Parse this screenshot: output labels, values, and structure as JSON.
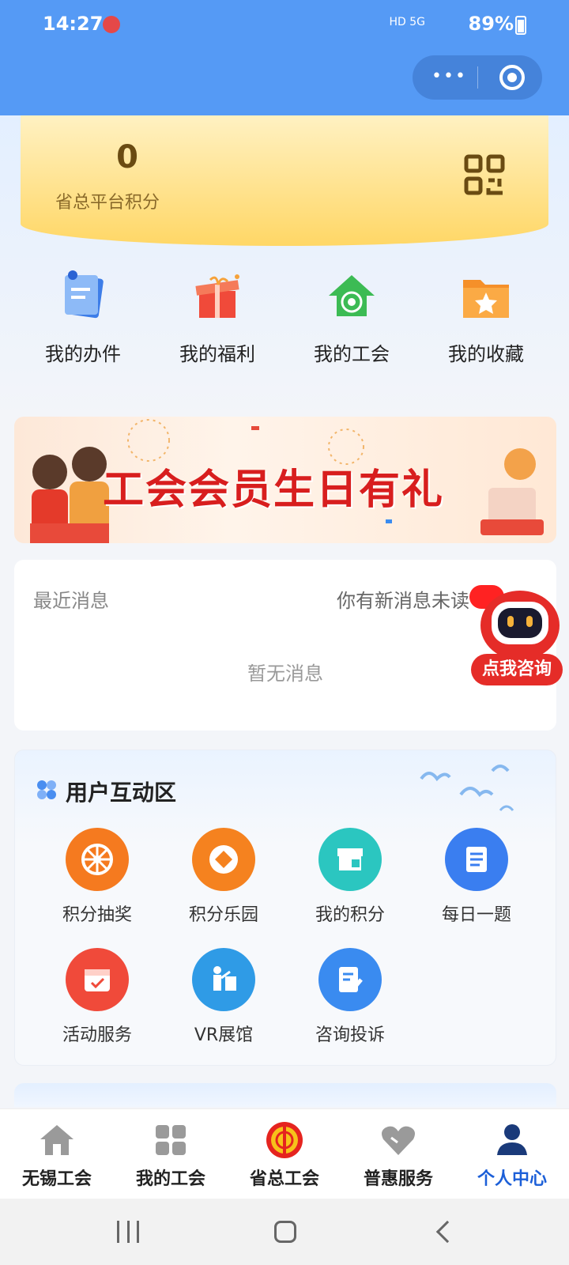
{
  "status": {
    "time": "14:27",
    "signal_text": "HD 5G",
    "battery": "89%"
  },
  "points": {
    "value": "0",
    "label": "省总平台积分"
  },
  "quick_menu": [
    {
      "label": "我的办件",
      "icon": "document-icon"
    },
    {
      "label": "我的福利",
      "icon": "gift-icon"
    },
    {
      "label": "我的工会",
      "icon": "union-home-icon"
    },
    {
      "label": "我的收藏",
      "icon": "favorite-folder-icon"
    }
  ],
  "banner": {
    "title": "工会会员生日有礼"
  },
  "messages": {
    "title": "最近消息",
    "unread_text": "你有新消息未读",
    "empty_text": "暂无消息"
  },
  "assistant": {
    "label": "点我咨询"
  },
  "interaction": {
    "title": "用户互动区",
    "items": [
      {
        "label": "积分抽奖",
        "color": "#f57a1f"
      },
      {
        "label": "积分乐园",
        "color": "#f5821f"
      },
      {
        "label": "我的积分",
        "color": "#2bc6c0"
      },
      {
        "label": "每日一题",
        "color": "#3a7ef0"
      },
      {
        "label": "活动服务",
        "color": "#f04a3a"
      },
      {
        "label": "VR展馆",
        "color": "#2f9be6"
      },
      {
        "label": "咨询投诉",
        "color": "#3a8bf0"
      }
    ]
  },
  "tabs": [
    {
      "label": "无锡工会",
      "icon": "home-icon"
    },
    {
      "label": "我的工会",
      "icon": "grid-icon"
    },
    {
      "label": "省总工会",
      "icon": "union-emblem-icon"
    },
    {
      "label": "普惠服务",
      "icon": "heart-icon"
    },
    {
      "label": "个人中心",
      "icon": "person-icon",
      "active": true
    }
  ]
}
